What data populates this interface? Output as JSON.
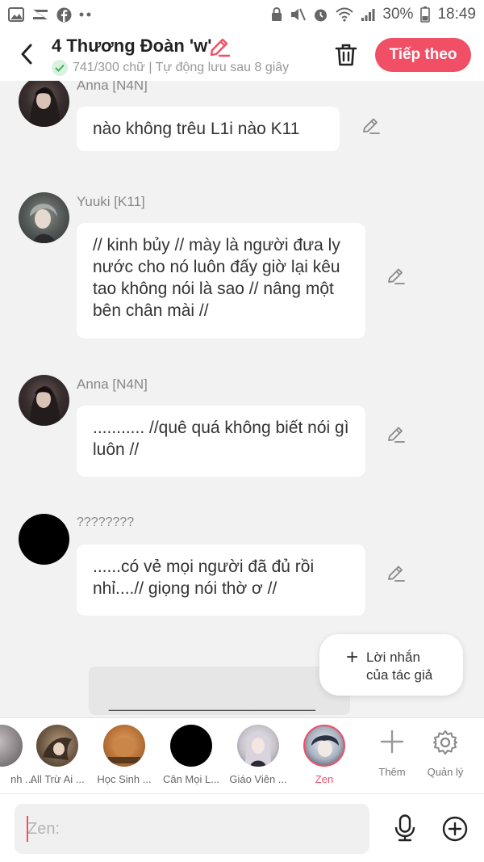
{
  "status": {
    "battery": "30%",
    "time": "18:49"
  },
  "header": {
    "title": "4 Thương Đoàn 'w'",
    "subtitle": "741/300 chữ | Tự động lưu sau 8 giây",
    "next_label": "Tiếp theo"
  },
  "messages": [
    {
      "name": "Anna [N4N]",
      "text": "nào không trêu L1i nào K11"
    },
    {
      "name": "Yuuki [K11]",
      "text": "// kinh bủy // mày là người đưa ly nước cho nó luôn đấy giờ lại kêu tao không nói là sao // nâng một bên chân mài //"
    },
    {
      "name": "Anna [N4N]",
      "text": "........... //quê quá không biết nói gì luôn //"
    },
    {
      "name": "????????",
      "text": "......có vẻ mọi người đã đủ rồi nhỉ....// giọng nói thờ ơ //"
    }
  ],
  "draft_line": "_______________________",
  "author_note": {
    "line1": "Lời nhắn",
    "line2": "của tác giả"
  },
  "characters": [
    {
      "label": "nh ..."
    },
    {
      "label": "All Trừ Ai ..."
    },
    {
      "label": "Học Sinh ..."
    },
    {
      "label": "Cân Mọi L..."
    },
    {
      "label": "Giáo Viên ..."
    },
    {
      "label": "Zen"
    }
  ],
  "tools": {
    "add_label": "Thêm",
    "manage_label": "Quản lý"
  },
  "input": {
    "placeholder": "Zen:"
  },
  "colors": {
    "accent": "#f04f66",
    "check_green": "#3cb35a"
  }
}
